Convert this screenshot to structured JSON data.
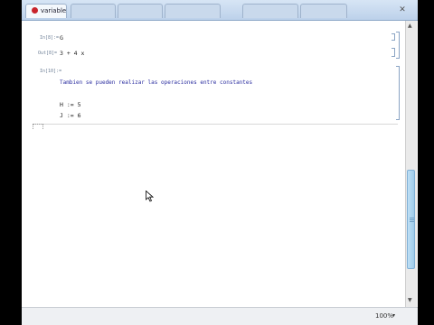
{
  "tabs": [
    {
      "label": "variable.nb",
      "active": true
    },
    {
      "label": "",
      "active": false
    },
    {
      "label": "",
      "active": false
    },
    {
      "label": "",
      "active": false
    },
    {
      "label": "",
      "active": false
    },
    {
      "label": "",
      "active": false
    }
  ],
  "cells": {
    "in1_label": "In[8]:=",
    "in1_code": "G",
    "out1_label": "Out[8]=",
    "out1_value": "3 + 4 x",
    "in2_label": "In[10]:=",
    "text": "Tambien se pueden realizar las operaciones entre constantes",
    "line1": "H := 5",
    "line2": "J := 6"
  },
  "status": {
    "zoom": "100%"
  },
  "colors": {
    "tab_icon": "#c8232b",
    "text_cell": "#2c2fa0",
    "scroll_thumb": "#9fcbea"
  }
}
